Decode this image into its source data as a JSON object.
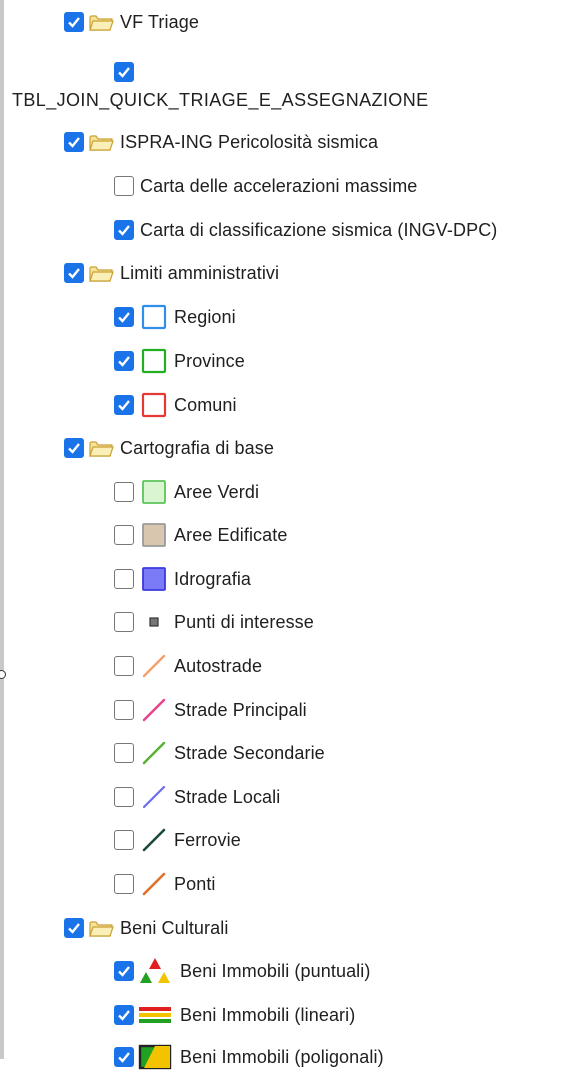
{
  "layer_tree": [
    {
      "kind": "group",
      "label": "VF Triage",
      "checked": true
    },
    {
      "kind": "item",
      "label": "TBL_JOIN_QUICK_TRIAGE_E_ASSEGNAZIONE",
      "checked": true,
      "symbol": "none"
    },
    {
      "kind": "group",
      "label": "ISPRA-ING Pericolosità sismica",
      "checked": true
    },
    {
      "kind": "item",
      "label": "Carta delle accelerazioni massime",
      "checked": false,
      "symbol": "none"
    },
    {
      "kind": "item",
      "label": "Carta di classificazione sismica (INGV-DPC)",
      "checked": true,
      "symbol": "none"
    },
    {
      "kind": "group",
      "label": "Limiti amministrativi",
      "checked": true
    },
    {
      "kind": "item",
      "label": "Regioni",
      "checked": true,
      "symbol": "square-outline",
      "color": "#2f8fea"
    },
    {
      "kind": "item",
      "label": "Province",
      "checked": true,
      "symbol": "square-outline",
      "color": "#22b022"
    },
    {
      "kind": "item",
      "label": "Comuni",
      "checked": true,
      "symbol": "square-outline",
      "color": "#e53935"
    },
    {
      "kind": "group",
      "label": "Cartografia di base",
      "checked": true
    },
    {
      "kind": "item",
      "label": "Aree Verdi",
      "checked": false,
      "symbol": "square-fill",
      "color": "#d9f5d2",
      "stroke": "#5fc35a"
    },
    {
      "kind": "item",
      "label": "Aree Edificate",
      "checked": false,
      "symbol": "square-fill",
      "color": "#d8c6af",
      "stroke": "#9a9a9a"
    },
    {
      "kind": "item",
      "label": "Idrografia",
      "checked": false,
      "symbol": "square-fill",
      "color": "#7b7bf7",
      "stroke": "#3a3ae0"
    },
    {
      "kind": "item",
      "label": "Punti di interesse",
      "checked": false,
      "symbol": "point",
      "color": "#555555"
    },
    {
      "kind": "item",
      "label": "Autostrade",
      "checked": false,
      "symbol": "line",
      "color": "#f2a06a"
    },
    {
      "kind": "item",
      "label": "Strade Principali",
      "checked": false,
      "symbol": "line",
      "color": "#e8418a"
    },
    {
      "kind": "item",
      "label": "Strade Secondarie",
      "checked": false,
      "symbol": "line",
      "color": "#58b130"
    },
    {
      "kind": "item",
      "label": "Strade Locali",
      "checked": false,
      "symbol": "line",
      "color": "#6b6bf0"
    },
    {
      "kind": "item",
      "label": "Ferrovie",
      "checked": false,
      "symbol": "line",
      "color": "#1b4a3c"
    },
    {
      "kind": "item",
      "label": "Ponti",
      "checked": false,
      "symbol": "line",
      "color": "#e0702a"
    },
    {
      "kind": "group",
      "label": "Beni Culturali",
      "checked": true
    },
    {
      "kind": "item",
      "label": "Beni Immobili (puntuali)",
      "checked": true,
      "symbol": "triangles"
    },
    {
      "kind": "item",
      "label": "Beni Immobili (lineari)",
      "checked": true,
      "symbol": "stripes"
    },
    {
      "kind": "item",
      "label": "Beni Immobili (poligonali)",
      "checked": true,
      "symbol": "polygon"
    }
  ]
}
